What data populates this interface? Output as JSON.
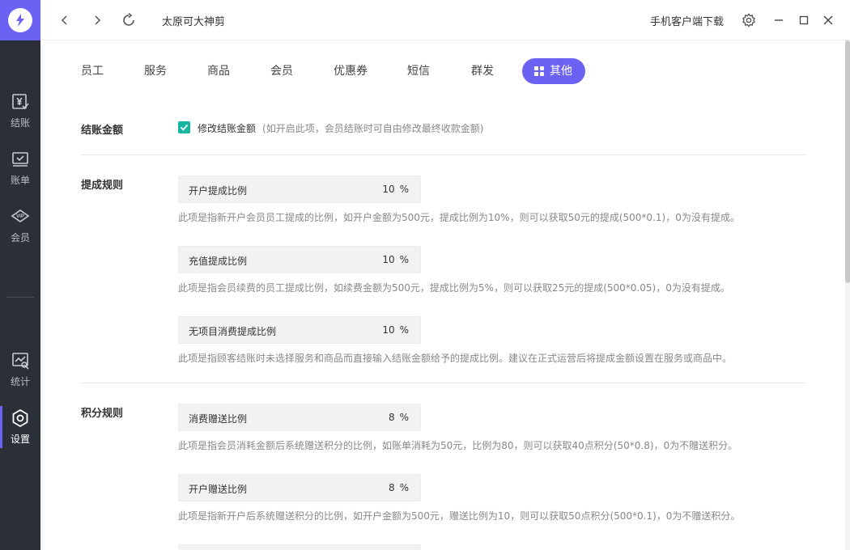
{
  "app": {
    "title": "太原可大神剪",
    "download_label": "手机客户端下载"
  },
  "sidebar": {
    "items": [
      {
        "label": "结账",
        "icon": "checkout-yen-icon"
      },
      {
        "label": "账单",
        "icon": "bill-monitor-icon"
      },
      {
        "label": "会员",
        "icon": "vip-diamond-icon"
      },
      {
        "label": "统计",
        "icon": "statistics-icon"
      },
      {
        "label": "设置",
        "icon": "settings-gear-icon"
      }
    ],
    "active": "设置"
  },
  "tabs": [
    {
      "label": "员工"
    },
    {
      "label": "服务"
    },
    {
      "label": "商品"
    },
    {
      "label": "会员"
    },
    {
      "label": "优惠券"
    },
    {
      "label": "短信"
    },
    {
      "label": "群发"
    },
    {
      "label": "其他"
    }
  ],
  "active_tab": "其他",
  "settings": {
    "checkout": {
      "section_label": "结账金额",
      "checkbox_label": "修改结账金额",
      "checkbox_hint": "(如开启此项，会员结账时可自由修改最终收款金额)",
      "checked": true
    },
    "commission": {
      "section_label": "提成规则",
      "fields": [
        {
          "label": "开户提成比例",
          "value": "10",
          "unit": "%",
          "desc": "此项是指新开户会员员工提成的比例，如开户金额为500元，提成比例为10%，则可以获取50元的提成(500*0.1)，0为没有提成。"
        },
        {
          "label": "充值提成比例",
          "value": "10",
          "unit": "%",
          "desc": "此项是指会员续费的员工提成比例，如续费金额为500元，提成比例为5%，则可以获取25元的提成(500*0.05)，0为没有提成。"
        },
        {
          "label": "无项目消费提成比例",
          "value": "10",
          "unit": "%",
          "desc": "此项是指顾客结账时未选择服务和商品而直接输入结账金额给予的提成比例。建议在正式运营后将提成金额设置在服务或商品中。"
        }
      ]
    },
    "points": {
      "section_label": "积分规则",
      "fields": [
        {
          "label": "消费赠送比例",
          "value": "8",
          "unit": "%",
          "desc": "此项是指会员消耗金额后系统赠送积分的比例，如账单消耗为50元，比例为80，则可以获取40点积分(50*0.8)，0为不赠送积分。"
        },
        {
          "label": "开户赠送比例",
          "value": "8",
          "unit": "%",
          "desc": "此项是指新开户后系统赠送积分的比例，如开户金额为500元，赠送比例为10，则可以获取50点积分(500*0.1)，0为不赠送积分。"
        }
      ]
    }
  },
  "colors": {
    "accent": "#6b62f4",
    "checkbox": "#17b6a3",
    "sidebar_bg": "#2b2f38"
  }
}
